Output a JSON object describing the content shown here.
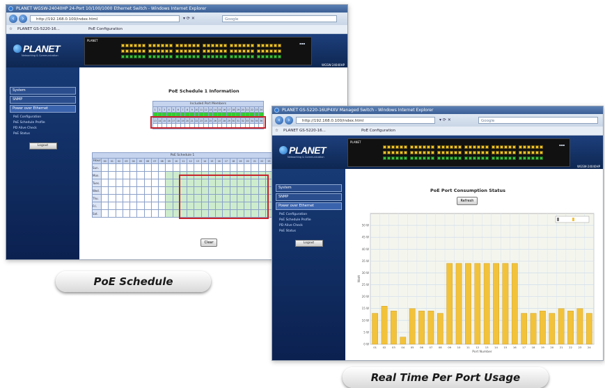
{
  "window1": {
    "title_bar": "PLANET WGSW-24040HP 24-Port 10/100/1000 Ethernet Switch - Windows Internet Explorer",
    "address": "http://192.168.0.100/index.html",
    "search_engine": "Google",
    "tabs": [
      "PLANET GS-5220-16...",
      "PoE Configuration"
    ],
    "brand": "PLANET",
    "tagline": "Networking & Communication",
    "switch_brand": "PLANET",
    "model": "WGSW-24040HP",
    "sidebar": {
      "buttons": [
        "System",
        "SNMP",
        "Power over Ethernet"
      ],
      "items": [
        "PoE Configuration",
        "PoE Schedule Profile",
        "PD Alive Check",
        "PoE Status"
      ],
      "logout": "Logout"
    },
    "page_title": "PoE Schedule 1 Information",
    "port_table_header": "Included Port Members",
    "port_numbers_top": [
      "1",
      "2",
      "3",
      "4",
      "5",
      "6",
      "7",
      "8",
      "9",
      "10",
      "11",
      "12",
      "13",
      "14",
      "15",
      "16",
      "17",
      "18",
      "19",
      "20",
      "21",
      "22",
      "23",
      "24"
    ],
    "port_numbers_bottom": [
      "13",
      "14",
      "15",
      "16",
      "17",
      "18",
      "19",
      "20",
      "21",
      "22",
      "23",
      "24",
      "25",
      "26",
      "27",
      "28",
      "29",
      "30",
      "31",
      "32",
      "33",
      "34",
      "35",
      "36"
    ],
    "schedule_header": "PoE Schedule 1",
    "hours_label": "Hour",
    "hours": [
      "00",
      "01",
      "02",
      "03",
      "04",
      "05",
      "06",
      "07",
      "08",
      "09",
      "10",
      "11",
      "12",
      "13",
      "14",
      "15",
      "16",
      "17",
      "18",
      "19",
      "20",
      "21",
      "22",
      "23"
    ],
    "days": [
      "Sun.",
      "Mon.",
      "Tues.",
      "Wed.",
      "Thu.",
      "Fri.",
      "Sat."
    ],
    "clear_button": "Clear",
    "caption": "PoE Schedule"
  },
  "window2": {
    "title_bar": "PLANET GS-5220-16UP4XV Managed Switch - Windows Internet Explorer",
    "address": "http://192.168.0.100/index.html",
    "search_engine": "Google",
    "tabs": [
      "PLANET GS-5220-16...",
      "PoE Configuration"
    ],
    "brand": "PLANET",
    "tagline": "Networking & Communication",
    "switch_brand": "PLANET",
    "model": "WGSW-24040HP",
    "sidebar": {
      "buttons": [
        "System",
        "SNMP",
        "Power over Ethernet"
      ],
      "items": [
        "PoE Configuration",
        "PoE Schedule Profile",
        "PD Alive Check",
        "PoE Status"
      ],
      "logout": "Logout"
    },
    "page_title": "PoE Port Consumption Status",
    "refresh_button": "Refresh",
    "caption": "Real Time Per Port Usage"
  },
  "colors": {
    "title_bar": "#3b5f95",
    "banner": "#0e2752",
    "sidebar": "#173a75",
    "schedule_fill": "#cdeccd",
    "active_ports": "#33cc33",
    "highlight_box": "#c8232c",
    "bar": "#f2c23a"
  },
  "chart_data": {
    "type": "bar",
    "title": "PoE Port Consumption Status",
    "ylabel": "Watt",
    "xlabel": "Port Number",
    "ylim": [
      0,
      55
    ],
    "grid": true,
    "legend_position": "top-right",
    "categories": [
      "01",
      "02",
      "03",
      "04",
      "05",
      "06",
      "07",
      "08",
      "09",
      "10",
      "11",
      "12",
      "13",
      "14",
      "15",
      "16",
      "17",
      "18",
      "19",
      "20",
      "21",
      "22",
      "23",
      "24"
    ],
    "series": [
      {
        "values": [
          13,
          16,
          14,
          3,
          15,
          14,
          14,
          13,
          34,
          34,
          34,
          34,
          34,
          34,
          34,
          34,
          13,
          13,
          14,
          13,
          15,
          14,
          15,
          13
        ]
      }
    ],
    "y_ticks": [
      "0 W",
      "5 W",
      "10 W",
      "15 W",
      "20 W",
      "25 W",
      "30 W",
      "35 W",
      "40 W",
      "45 W",
      "50 W"
    ]
  }
}
